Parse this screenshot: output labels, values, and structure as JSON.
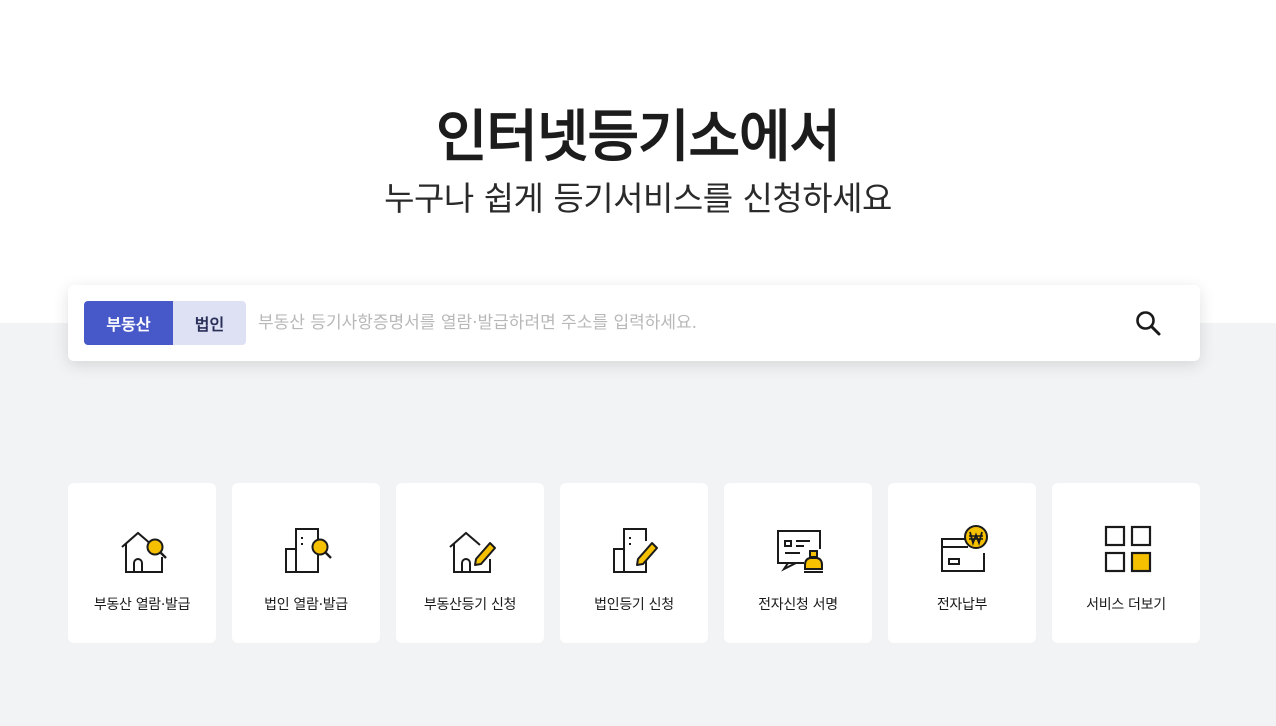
{
  "hero": {
    "title": "인터넷등기소에서",
    "subtitle": "누구나 쉽게 등기서비스를 신청하세요"
  },
  "search": {
    "tabs": [
      {
        "label": "부동산",
        "active": true
      },
      {
        "label": "법인",
        "active": false
      }
    ],
    "placeholder": "부동산 등기사항증명서를 열람·발급하려면 주소를 입력하세요.",
    "value": ""
  },
  "services": [
    {
      "label": "부동산 열람·발급",
      "icon": "house-search-icon"
    },
    {
      "label": "법인 열람·발급",
      "icon": "building-search-icon"
    },
    {
      "label": "부동산등기 신청",
      "icon": "house-edit-icon"
    },
    {
      "label": "법인등기 신청",
      "icon": "building-edit-icon"
    },
    {
      "label": "전자신청 서명",
      "icon": "e-sign-stamp-icon"
    },
    {
      "label": "전자납부",
      "icon": "e-payment-won-icon"
    },
    {
      "label": "서비스 더보기",
      "icon": "more-grid-icon"
    }
  ],
  "colors": {
    "accent": "#4758c8",
    "accent_light": "#dde1f3",
    "icon_yellow": "#f5c000",
    "bg_gray": "#f2f3f5"
  }
}
